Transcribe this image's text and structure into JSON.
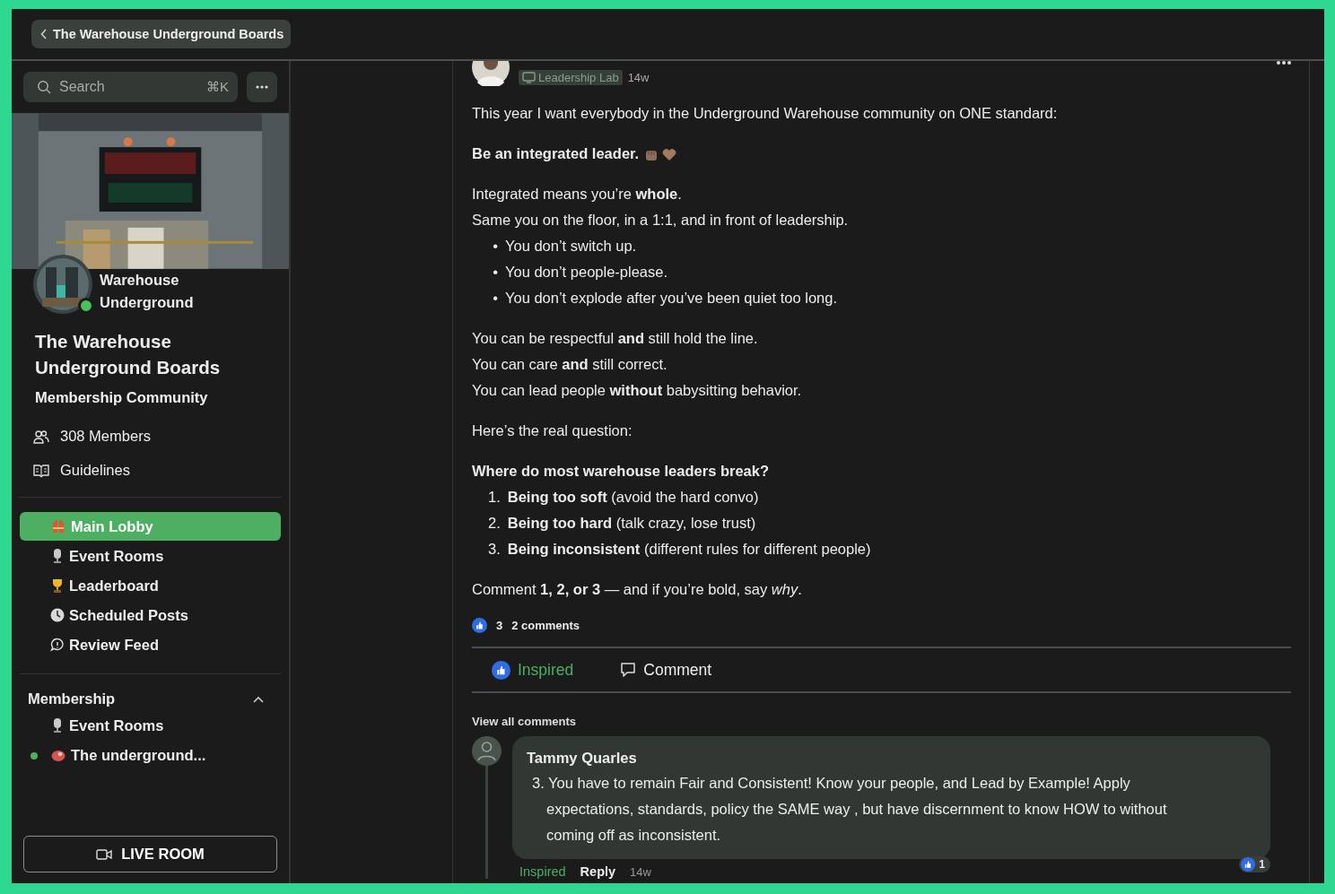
{
  "top_bar": {
    "back_label": "The Warehouse Underground Boards"
  },
  "sidebar": {
    "search": {
      "placeholder": "Search",
      "shortcut": "⌘K"
    },
    "community": {
      "name": "Warehouse Underground",
      "online": true,
      "title": "The Warehouse Underground Boards",
      "subtitle": "Membership Community"
    },
    "links": [
      {
        "kind": "people",
        "label": "308 Members"
      },
      {
        "kind": "book",
        "label": "Guidelines"
      }
    ],
    "nav": [
      {
        "kind": "vest",
        "label": "Main Lobby",
        "selected": true
      },
      {
        "kind": "mic",
        "label": "Event Rooms",
        "selected": false
      },
      {
        "kind": "trophy",
        "label": "Leaderboard",
        "selected": false
      },
      {
        "kind": "clock",
        "label": "Scheduled Posts",
        "selected": false
      },
      {
        "kind": "chat",
        "label": "Review Feed",
        "selected": false
      }
    ],
    "groups": [
      {
        "label": "Membership",
        "expanded": true,
        "items": [
          {
            "kind": "mic",
            "label": "Event Rooms",
            "unread": false,
            "selected": false
          },
          {
            "kind": "meat",
            "label": "The underground...",
            "unread": true,
            "selected": false
          }
        ]
      }
    ],
    "live_button": "LIVE ROOM"
  },
  "post": {
    "tag": "Leadership Lab",
    "time": "14w",
    "sections": [
      {
        "lines": [
          "This year I want everybody in the Underground Warehouse community on ONE standard:"
        ]
      },
      {
        "lines": [
          "**Be an integrated leader.**"
        ],
        "emoji": [
          {
            "kind": "fist"
          },
          {
            "kind": "heart"
          }
        ]
      },
      {
        "lines": [
          "Integrated means you’re **whole**.",
          "Same you on the floor, in a 1:1, and in front of leadership."
        ],
        "list": {
          "items": [
            {
              "marker": "•",
              "text": "You don’t switch up."
            },
            {
              "marker": "•",
              "text": "You don’t people-please."
            },
            {
              "marker": "•",
              "text": "You don’t explode after you’ve been quiet too long."
            }
          ]
        }
      },
      {
        "lines": [
          "You can be respectful **and** still hold the line.",
          "You can care **and** still correct.",
          "You can lead people **without** babysitting behavior."
        ]
      },
      {
        "lines": [
          "Here’s the real question:"
        ]
      },
      {
        "lines": [
          "**Where do most warehouse leaders break?**"
        ],
        "list": {
          "items": [
            {
              "marker": "1.",
              "text": "**Being too soft** (avoid the hard convo)"
            },
            {
              "marker": "2.",
              "text": "**Being too hard** (talk crazy, lose trust)"
            },
            {
              "marker": "3.",
              "text": "**Being inconsistent** (different rules for different people)"
            }
          ]
        }
      },
      {
        "lines": [
          "Comment **1, 2, or 3** — and if you’re bold, say *why*."
        ]
      }
    ],
    "reaction_count": "3",
    "comment_count": "2 comments",
    "actions": [
      {
        "kind": "like",
        "label": "Inspired",
        "selected": true
      },
      {
        "kind": "comment",
        "label": "Comment",
        "selected": false
      }
    ],
    "view_all": "View all comments",
    "comments": [
      {
        "author": "Tammy Quarles",
        "text": "3. You have to remain Fair and Consistent! Know your people, and Lead by Example! Apply expectations, standards, policy the SAME way , but have discernment to know HOW to without coming off as inconsistent.",
        "like_label": "Inspired",
        "liked": true,
        "reply_label": "Reply",
        "time": "14w",
        "reactions": "1"
      }
    ]
  }
}
